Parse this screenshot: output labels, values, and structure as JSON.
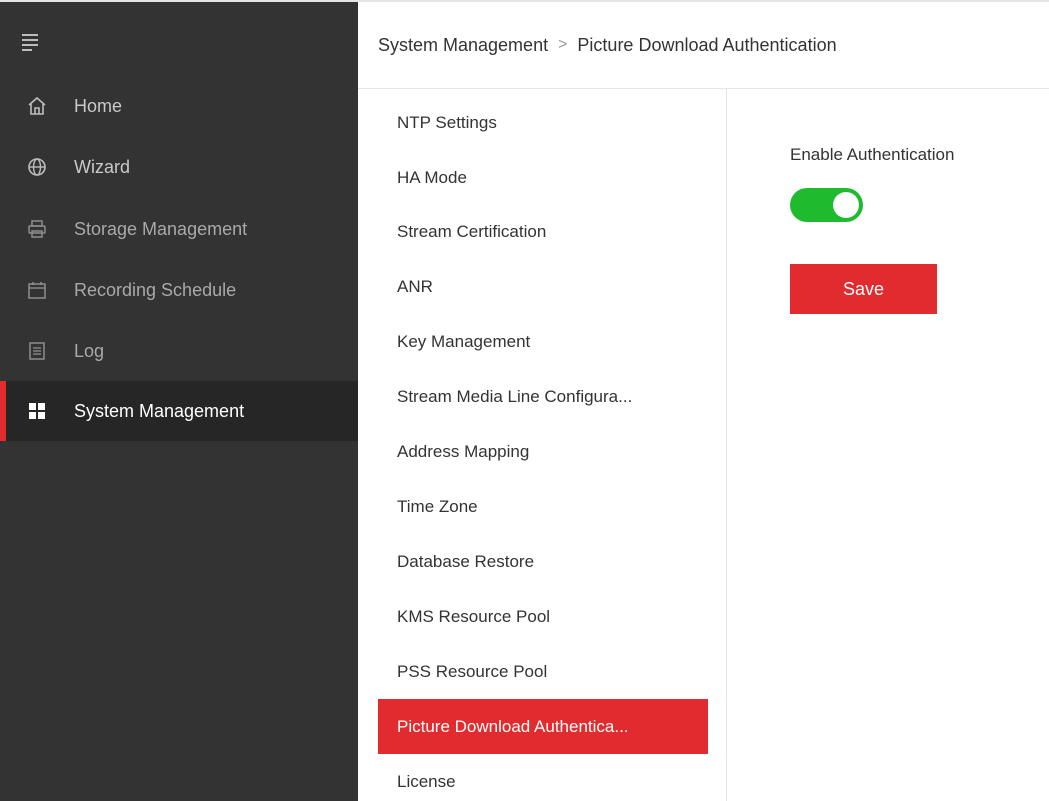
{
  "sidebar": {
    "items": [
      {
        "label": "Home",
        "icon": "home-icon"
      },
      {
        "label": "Wizard",
        "icon": "globe-icon"
      },
      {
        "label": "Storage Management",
        "icon": "printer-icon"
      },
      {
        "label": "Recording Schedule",
        "icon": "calendar-icon"
      },
      {
        "label": "Log",
        "icon": "log-icon"
      },
      {
        "label": "System Management",
        "icon": "grid-icon"
      }
    ],
    "active_index": 5
  },
  "breadcrumb": {
    "parent": "System Management",
    "separator": ">",
    "current": "Picture Download Authentication"
  },
  "submenu": {
    "items": [
      {
        "label": "NTP Settings"
      },
      {
        "label": "HA Mode"
      },
      {
        "label": "Stream Certification"
      },
      {
        "label": "ANR"
      },
      {
        "label": "Key Management"
      },
      {
        "label": "Stream Media Line Configura..."
      },
      {
        "label": "Address Mapping"
      },
      {
        "label": "Time Zone"
      },
      {
        "label": "Database Restore"
      },
      {
        "label": "KMS Resource Pool"
      },
      {
        "label": "PSS Resource Pool"
      },
      {
        "label": "Picture Download Authentica..."
      },
      {
        "label": "License"
      }
    ],
    "active_index": 11
  },
  "content": {
    "enable_label": "Enable Authentication",
    "enabled": true,
    "save_label": "Save"
  },
  "colors": {
    "sidebar_bg": "#333333",
    "accent_red": "#e22b2f",
    "toggle_green": "#1fba2e"
  }
}
